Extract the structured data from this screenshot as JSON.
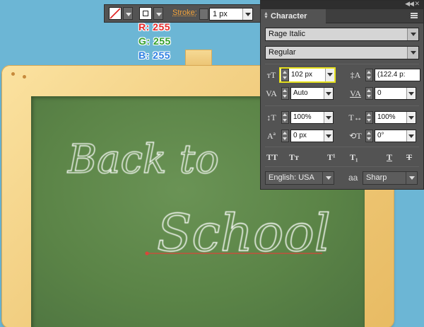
{
  "chalkboard": {
    "line1": "Back to",
    "line2": "School",
    "colors": {
      "chalk": "#ffffff",
      "board": "#5b8447",
      "frame": "#f1cd7f",
      "guide": "#d9463a"
    }
  },
  "control_bar": {
    "stroke_label": "Stroke:",
    "stroke_value": "1 px"
  },
  "rgb_readout": {
    "r": "R: 255",
    "g": "G: 255",
    "b": "B: 255"
  },
  "character_panel": {
    "tab_label": "Character",
    "font_family": "Rage Italic",
    "font_style": "Regular",
    "font_size": "102 px",
    "leading": "(122.4 p:",
    "kerning": "Auto",
    "tracking": "0",
    "vertical_scale": "100%",
    "horizontal_scale": "100%",
    "baseline_shift": "0 px",
    "rotation": "0°",
    "language": "English: USA",
    "antialias": "Sharp",
    "antialias_icon_text": "aa"
  }
}
